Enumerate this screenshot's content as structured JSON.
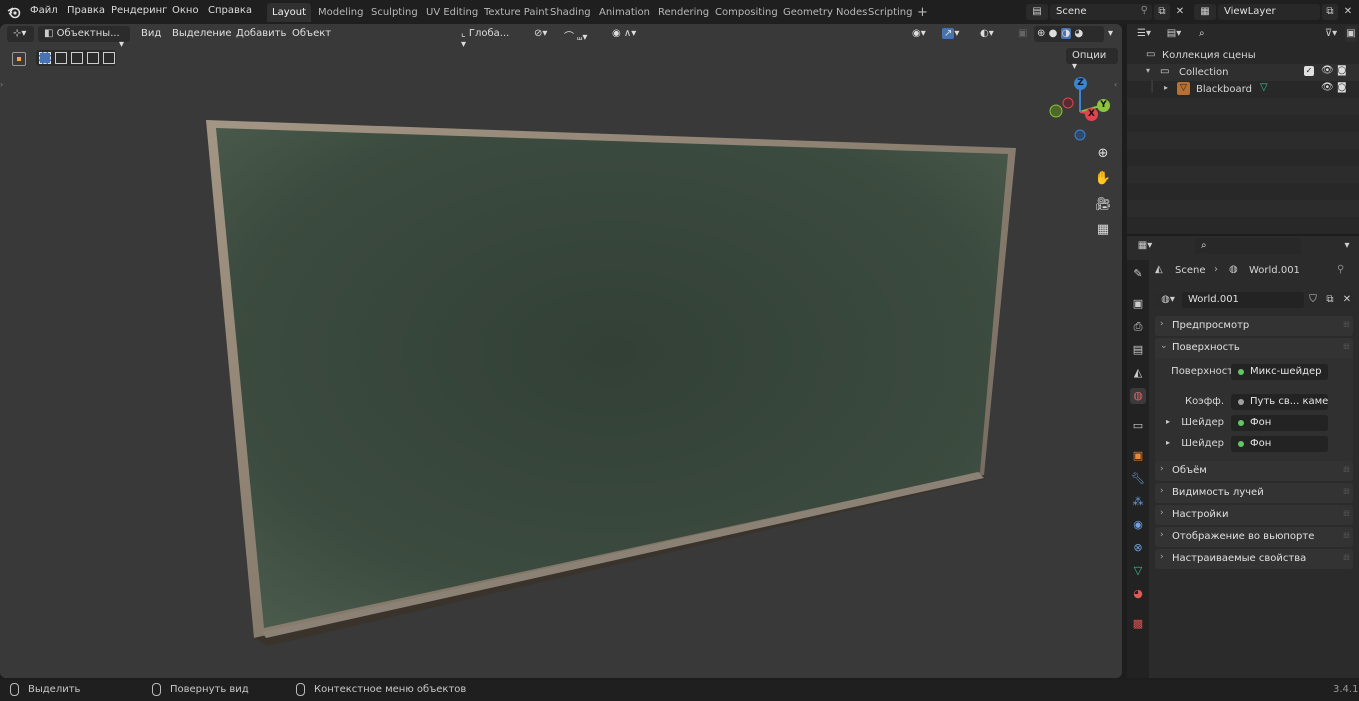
{
  "menu": {
    "items": [
      "Файл",
      "Правка",
      "Рендеринг",
      "Окно",
      "Справка"
    ]
  },
  "workspaces": {
    "tabs": [
      "Layout",
      "Modeling",
      "Sculpting",
      "UV Editing",
      "Texture Paint",
      "Shading",
      "Animation",
      "Rendering",
      "Compositing",
      "Geometry Nodes",
      "Scripting"
    ],
    "active": "Layout",
    "add_label": "+"
  },
  "scene": {
    "name": "Scene"
  },
  "view_layer": {
    "name": "ViewLayer"
  },
  "viewport": {
    "mode": "Объектны...",
    "menus": [
      "Вид",
      "Выделение",
      "Добавить",
      "Объект"
    ],
    "transform_orientation": "Глоба...",
    "options_label": "Опции",
    "gizmo": {
      "x": "X",
      "y": "Y",
      "z": "Z"
    }
  },
  "outliner": {
    "scene_collection": "Коллекция сцены",
    "collection": "Collection",
    "object": "Blackboard"
  },
  "properties": {
    "breadcrumb_scene": "Scene",
    "breadcrumb_world": "World.001",
    "world_name": "World.001",
    "panels": {
      "preview": "Предпросмотр",
      "surface": "Поверхность",
      "volume": "Объём",
      "ray_visibility": "Видимость лучей",
      "settings": "Настройки",
      "viewport_display": "Отображение во вьюпорте",
      "custom_props": "Настраиваемые свойства"
    },
    "surface": {
      "label": "Поверхность",
      "value": "Микс-шейдер",
      "fac_label": "Коэфф.",
      "fac_value": "Путь св... камеры",
      "shader1_label": "Шейдер",
      "shader1_value": "Фон",
      "shader2_label": "Шейдер",
      "shader2_value": "Фон"
    }
  },
  "statusbar": {
    "select": "Выделить",
    "rotate": "Повернуть вид",
    "context": "Контекстное меню объектов",
    "version": "3.4.1"
  },
  "colors": {
    "accent": "#4772b3",
    "socket_green": "#63c763",
    "gizmo_x": "#e5424f",
    "gizmo_y": "#8bc43f",
    "gizmo_z": "#3b83d6",
    "board_green": "#3a4a3d",
    "frame": "#8a7e70"
  }
}
